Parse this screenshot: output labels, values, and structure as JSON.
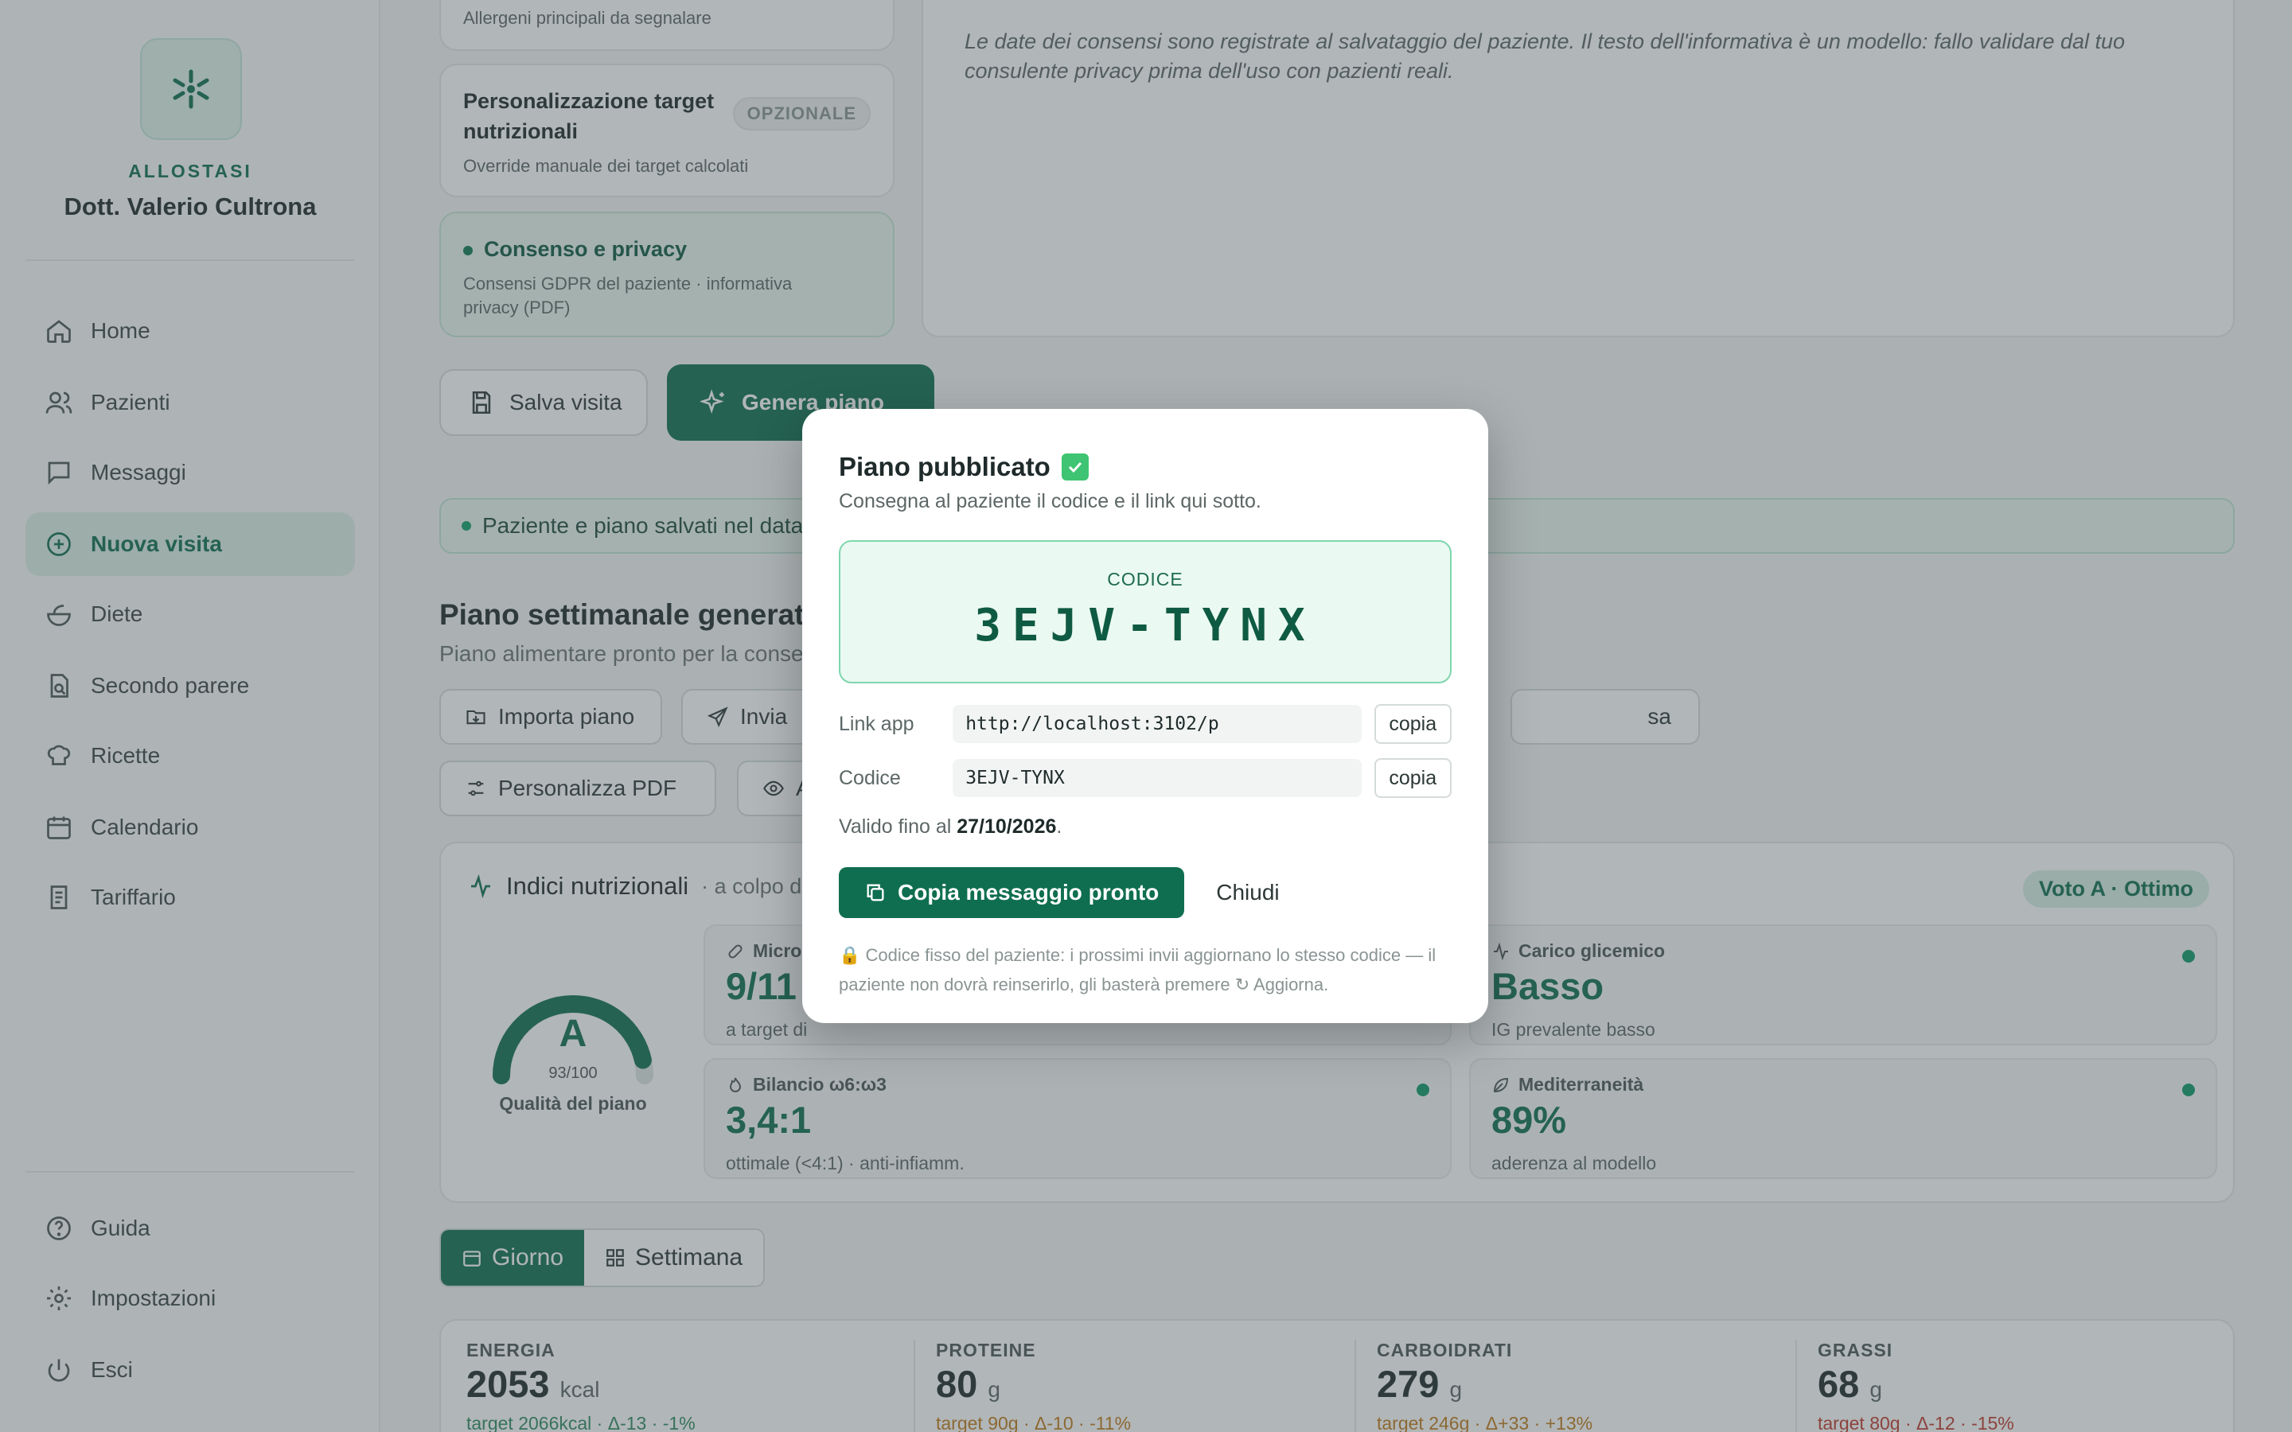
{
  "sidebar": {
    "brand": "ALLOSTASI",
    "doctor": "Dott. Valerio Cultrona",
    "nav": [
      {
        "label": "Home",
        "icon": "home-icon"
      },
      {
        "label": "Pazienti",
        "icon": "users-icon"
      },
      {
        "label": "Messaggi",
        "icon": "message-icon"
      },
      {
        "label": "Nuova visita",
        "icon": "plus-circle-icon",
        "active": true
      },
      {
        "label": "Diete",
        "icon": "salad-icon"
      },
      {
        "label": "Secondo parere",
        "icon": "file-search-icon"
      },
      {
        "label": "Ricette",
        "icon": "chef-hat-icon"
      },
      {
        "label": "Calendario",
        "icon": "calendar-icon"
      },
      {
        "label": "Tariffario",
        "icon": "receipt-icon"
      }
    ],
    "footer": [
      {
        "label": "Guida",
        "icon": "help-icon"
      },
      {
        "label": "Impostazioni",
        "icon": "gear-icon"
      },
      {
        "label": "Esci",
        "icon": "power-icon"
      }
    ]
  },
  "sections": {
    "allergeni_sub": "Allergeni principali da segnalare",
    "target_title": "Personalizzazione target nutrizionali",
    "target_badge": "OPZIONALE",
    "target_sub": "Override manuale dei target calcolati",
    "consenso_title": "Consenso e privacy",
    "consenso_sub": "Consensi GDPR del paziente · informativa privacy (PDF)"
  },
  "info_note": "Le date dei consensi sono registrate al salvataggio del paziente. Il testo dell'informativa è un modello: fallo validare dal tuo consulente privacy prima dell'uso con pazienti reali.",
  "actions": {
    "save": "Salva visita",
    "generate": "Genera piano"
  },
  "banner": "Paziente e piano salvati nel datal",
  "plan": {
    "title": "Piano settimanale generato",
    "subtitle": "Piano alimentare pronto per la conseg",
    "tools_row1": [
      "Importa piano",
      "Invia",
      "sa"
    ],
    "tools_row2": [
      "Personalizza PDF",
      "Ant"
    ]
  },
  "indices": {
    "title": "Indici nutrizionali",
    "subtitle": "· a colpo d",
    "grade_pill": "Voto A · Ottimo",
    "gauge_letter": "A",
    "gauge_score": "93/100",
    "gauge_value": 0.93,
    "gauge_label": "Qualità del piano",
    "metrics": [
      {
        "label": "Micro",
        "value": "9/11",
        "sub": "a target di"
      },
      {
        "label": "Carico glicemico",
        "value": "Basso",
        "sub": "IG prevalente basso"
      },
      {
        "label": "Bilancio ω6:ω3",
        "value": "3,4:1",
        "sub": "ottimale (<4:1) · anti-infiamm."
      },
      {
        "label": "Mediterraneità",
        "value": "89%",
        "sub": "aderenza al modello"
      }
    ]
  },
  "view_toggle": {
    "day": "Giorno",
    "week": "Settimana"
  },
  "macros": [
    {
      "key": "ENERGIA",
      "value": "2053",
      "unit": "kcal",
      "target": "target 2066kcal · Δ-13 · -1%",
      "color": "#2f8a5f"
    },
    {
      "key": "PROTEINE",
      "value": "80",
      "unit": "g",
      "target": "target 90g · Δ-10 · -11%",
      "color": "#c07a1a"
    },
    {
      "key": "CARBOIDRATI",
      "value": "279",
      "unit": "g",
      "target": "target 246g · Δ+33 · +13%",
      "color": "#c07a1a"
    },
    {
      "key": "GRASSI",
      "value": "68",
      "unit": "g",
      "target": "target 80g · Δ-12 · -15%",
      "color": "#c0392b"
    }
  ],
  "modal": {
    "title": "Piano pubblicato",
    "subtitle": "Consegna al paziente il codice e il link qui sotto.",
    "code_label": "CODICE",
    "code": "3EJV-TYNX",
    "link_label": "Link app",
    "link_value": "http://localhost:3102/p",
    "code_row_label": "Codice",
    "code_row_value": "3EJV-TYNX",
    "copy": "copia",
    "valid_prefix": "Valido fino al",
    "valid_date": "27/10/2026",
    "valid_suffix": ".",
    "copy_message": "Copia messaggio pronto",
    "close": "Chiudi",
    "note": "Codice fisso del paziente: i prossimi invii aggiornano lo stesso codice — il paziente non dovrà reinserirlo, gli basterà premere ↻ Aggiorna."
  }
}
